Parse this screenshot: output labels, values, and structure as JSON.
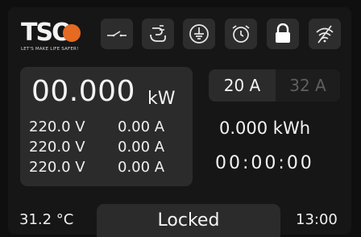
{
  "brand": {
    "logo_text": "TSO",
    "tagline": "LET'S MAKE LIFE SAFER!",
    "globe_color": "#e56a22"
  },
  "status_icons": [
    {
      "name": "switch-icon"
    },
    {
      "name": "hand-plug-icon"
    },
    {
      "name": "ground-icon"
    },
    {
      "name": "alarm-clock-icon"
    },
    {
      "name": "lock-icon"
    },
    {
      "name": "wifi-off-icon"
    }
  ],
  "power": {
    "value": "00.000",
    "unit": "kW"
  },
  "phases": [
    {
      "voltage": "220.0 V",
      "current": "0.00 A"
    },
    {
      "voltage": "220.0 V",
      "current": "0.00 A"
    },
    {
      "voltage": "220.0 V",
      "current": "0.00 A"
    }
  ],
  "current_select": {
    "options": [
      "20 A",
      "32 A"
    ],
    "selected": "20 A"
  },
  "energy": "0.000 kWh",
  "timer": "00:00:00",
  "temperature": "31.2 °C",
  "status": "Locked",
  "clock": "13:00",
  "colors": {
    "background": "#161616",
    "panel": "#2b2b2b",
    "text": "#f4f4f4",
    "inactive_text": "#5f5f5f"
  }
}
